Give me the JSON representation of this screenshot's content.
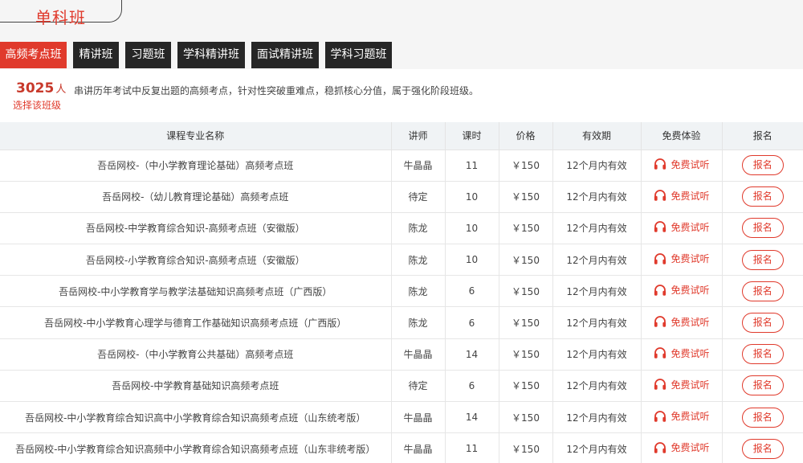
{
  "page_title": "单科班",
  "tabs": [
    {
      "label": "高频考点班",
      "active": true
    },
    {
      "label": "精讲班",
      "active": false
    },
    {
      "label": "习题班",
      "active": false
    },
    {
      "label": "学科精讲班",
      "active": false
    },
    {
      "label": "面试精讲班",
      "active": false
    },
    {
      "label": "学科习题班",
      "active": false
    }
  ],
  "enrollment": {
    "count": "3025",
    "unit": "人",
    "choose_label": "选择该班级"
  },
  "description": "串讲历年考试中反复出题的高频考点，针对性突破重难点，稳抓核心分值，属于强化阶段班级。",
  "table": {
    "headers": [
      "课程专业名称",
      "讲师",
      "课时",
      "价格",
      "有效期",
      "免费体验",
      "报名"
    ],
    "trial_label": "免费试听",
    "signup_label": "报名",
    "rows": [
      {
        "name": "吾岳网校-（中小学教育理论基础）高频考点班",
        "teacher": "牛晶晶",
        "hours": "11",
        "price": "￥150",
        "validity": "12个月内有效"
      },
      {
        "name": "吾岳网校-（幼儿教育理论基础）高频考点班",
        "teacher": "待定",
        "hours": "10",
        "price": "￥150",
        "validity": "12个月内有效"
      },
      {
        "name": "吾岳网校-中学教育综合知识-高频考点班（安徽版）",
        "teacher": "陈龙",
        "hours": "10",
        "price": "￥150",
        "validity": "12个月内有效"
      },
      {
        "name": "吾岳网校-小学教育综合知识-高频考点班（安徽版）",
        "teacher": "陈龙",
        "hours": "10",
        "price": "￥150",
        "validity": "12个月内有效"
      },
      {
        "name": "吾岳网校-中小学教育学与教学法基础知识高频考点班（广西版）",
        "teacher": "陈龙",
        "hours": "6",
        "price": "￥150",
        "validity": "12个月内有效"
      },
      {
        "name": "吾岳网校-中小学教育心理学与德育工作基础知识高频考点班（广西版）",
        "teacher": "陈龙",
        "hours": "6",
        "price": "￥150",
        "validity": "12个月内有效"
      },
      {
        "name": "吾岳网校-（中小学教育公共基础）高频考点班",
        "teacher": "牛晶晶",
        "hours": "14",
        "price": "￥150",
        "validity": "12个月内有效"
      },
      {
        "name": "吾岳网校-中学教育基础知识高频考点班",
        "teacher": "待定",
        "hours": "6",
        "price": "￥150",
        "validity": "12个月内有效"
      },
      {
        "name": "吾岳网校-中小学教育综合知识高中小学教育综合知识高频考点班（山东统考版）",
        "teacher": "牛晶晶",
        "hours": "14",
        "price": "￥150",
        "validity": "12个月内有效"
      },
      {
        "name": "吾岳网校-中小学教育综合知识高频中小学教育综合知识高频考点班（山东非统考版）",
        "teacher": "牛晶晶",
        "hours": "11",
        "price": "￥150",
        "validity": "12个月内有效"
      }
    ]
  },
  "colors": {
    "accent": "#e03a2c",
    "tab_dark": "#262626",
    "header_bg": "#f0f3f5"
  },
  "icons": {
    "trial": "headphones-icon"
  }
}
